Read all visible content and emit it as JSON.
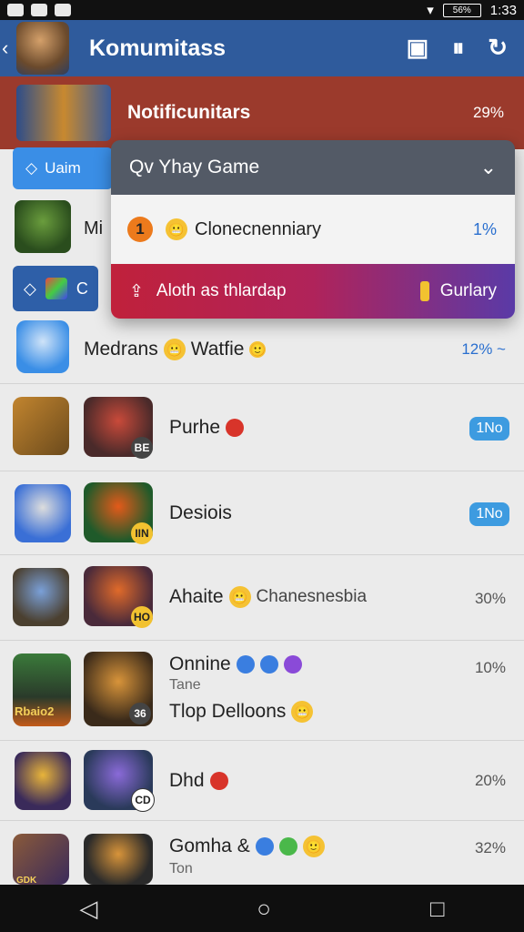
{
  "status_bar": {
    "time": "1:33",
    "battery": "56%"
  },
  "app_bar": {
    "back": "‹",
    "title": "Komumitass",
    "action_icons": [
      "briefcase-icon",
      "bookmark-icon",
      "refresh-icon"
    ]
  },
  "notification": {
    "title": "Notificunitars",
    "percent": "29%"
  },
  "tab_chip": {
    "label": "Uaim"
  },
  "row2": {
    "text": "Mi"
  },
  "chip2": {
    "label": "C"
  },
  "popup": {
    "header": "Qv Yhay Game",
    "middle": {
      "badge": "1",
      "label": "Clonecnenniary",
      "percent": "1%"
    },
    "bottom": {
      "label": "Aloth as thlardap",
      "right_label": "Gurlary"
    }
  },
  "items": [
    {
      "title": "Medrans",
      "title2": "Watfie",
      "value": "12% ~"
    },
    {
      "title": "Purhe",
      "value": "1No",
      "badge": "BE"
    },
    {
      "title": "Desiois",
      "value": "1No",
      "badge": "IIN"
    },
    {
      "title": "Ahaite",
      "title2": "Chanesnesbia",
      "value": "30%",
      "badge": "HO"
    },
    {
      "title": "Onnine",
      "sub": "Tane",
      "title3": "Tlop Delloons",
      "value": "10%",
      "badge": "36",
      "icon_label": "Rbaio2"
    },
    {
      "title": "Dhd",
      "value": "20%",
      "badge": "CD"
    },
    {
      "title": "Gomha &",
      "sub": "Ton",
      "value": "32%",
      "icon_label": "GDK"
    }
  ],
  "colors": {
    "appbar": "#2f5b9c",
    "notif": "#9b3a2c",
    "accent": "#3d9be0"
  }
}
